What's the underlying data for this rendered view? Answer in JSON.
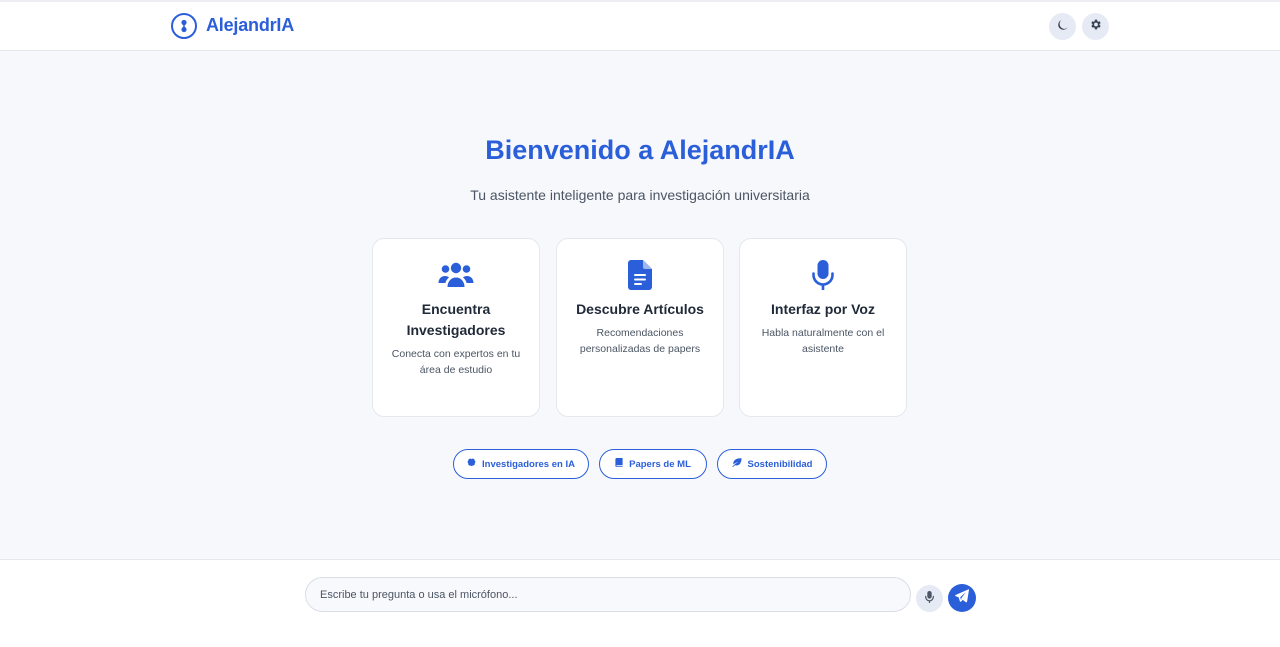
{
  "header": {
    "brand_name": "AlejandrIA",
    "logo_icon": "brain-circle-icon",
    "theme_toggle_icon": "moon-icon",
    "settings_icon": "gear-icon"
  },
  "hero": {
    "title": "Bienvenido a AlejandrIA",
    "subtitle": "Tu asistente inteligente para investigación universitaria"
  },
  "features": [
    {
      "icon": "users-icon",
      "title": "Encuentra Investigadores",
      "description": "Conecta con expertos en tu área de estudio"
    },
    {
      "icon": "document-icon",
      "title": "Descubre Artículos",
      "description": "Recomendaciones personalizadas de papers"
    },
    {
      "icon": "microphone-icon",
      "title": "Interfaz por Voz",
      "description": "Habla naturalmente con el asistente"
    }
  ],
  "suggestions": [
    {
      "icon": "brain-icon",
      "label": "Investigadores en IA"
    },
    {
      "icon": "book-icon",
      "label": "Papers de ML"
    },
    {
      "icon": "leaf-icon",
      "label": "Sostenibilidad"
    }
  ],
  "input": {
    "placeholder": "Escribe tu pregunta o usa el micrófono...",
    "value": ""
  },
  "colors": {
    "accent": "#2b5fd9",
    "background": "#f7f8fc",
    "surface": "#ffffff"
  }
}
